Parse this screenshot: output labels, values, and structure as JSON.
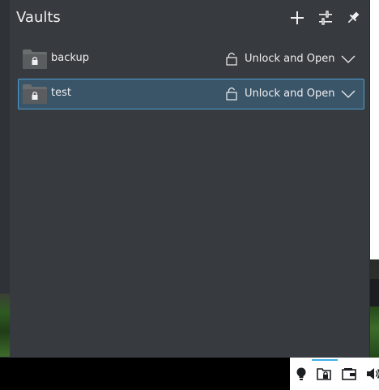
{
  "window": {
    "title": "Vaults"
  },
  "header": {
    "add_icon": "plus-icon",
    "configure_icon": "sliders-icon",
    "pin_icon": "pin-icon"
  },
  "vaults": [
    {
      "name": "backup",
      "action_label": "Unlock and Open",
      "selected": false
    },
    {
      "name": "test",
      "action_label": "Unlock and Open",
      "selected": true
    }
  ],
  "tray": {
    "icons": [
      "lightbulb-icon",
      "vault-icon",
      "wallet-icon",
      "volume-icon"
    ]
  },
  "colors": {
    "popup_bg": "#373a3e",
    "selection_bg": "#3a5468",
    "selection_border": "#4d9fd3",
    "text": "#eff0f1",
    "accent": "#3daee9"
  }
}
